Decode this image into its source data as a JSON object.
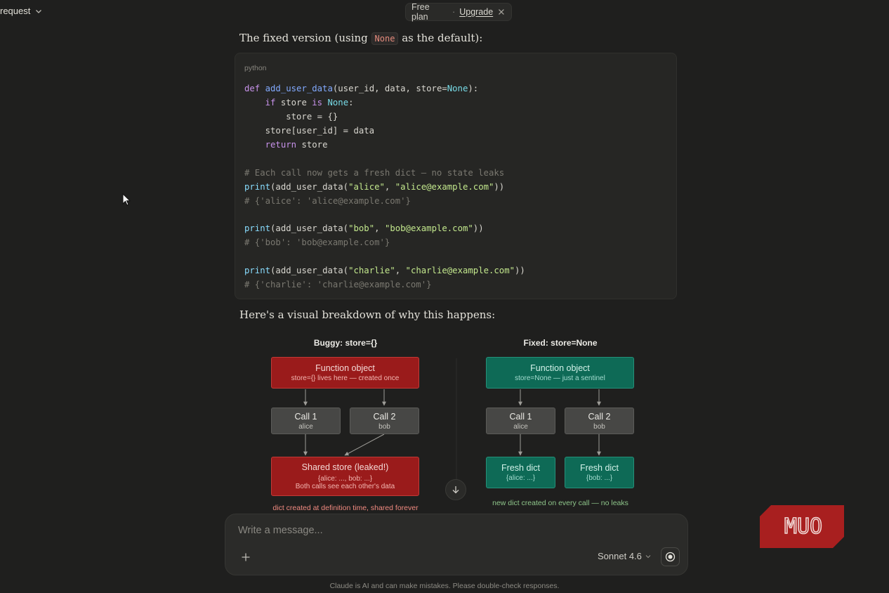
{
  "header": {
    "chat_title": "request",
    "plan": "Free plan",
    "separator": "·",
    "upgrade": "Upgrade"
  },
  "message": {
    "intro_before": "The fixed version (using ",
    "intro_code": "None",
    "intro_after": " as the default):",
    "code_language": "python",
    "code_lines": [
      "def add_user_data(user_id, data, store=None):",
      "    if store is None:",
      "        store = {}",
      "    store[user_id] = data",
      "    return store",
      "",
      "# Each call now gets a fresh dict — no state leaks",
      "print(add_user_data(\"alice\", \"alice@example.com\"))",
      "# {'alice': 'alice@example.com'}",
      "",
      "print(add_user_data(\"bob\", \"bob@example.com\"))",
      "# {'bob': 'bob@example.com'}",
      "",
      "print(add_user_data(\"charlie\", \"charlie@example.com\"))",
      "# {'charlie': 'charlie@example.com'}"
    ],
    "breakdown_heading": "Here's a visual breakdown of why this happens:"
  },
  "diagram": {
    "buggy": {
      "title": "Buggy: store={}",
      "function_title": "Function object",
      "function_sub": "store={} lives here — created once",
      "call1_title": "Call 1",
      "call1_sub": "alice",
      "call2_title": "Call 2",
      "call2_sub": "bob",
      "store_title": "Shared store (leaked!)",
      "store_sub1": "{alice: ..., bob: ...}",
      "store_sub2": "Both calls see each other's data",
      "caption": "dict created at definition time, shared forever"
    },
    "fixed": {
      "title": "Fixed: store=None",
      "function_title": "Function object",
      "function_sub": "store=None — just a sentinel",
      "call1_title": "Call 1",
      "call1_sub": "alice",
      "call2_title": "Call 2",
      "call2_sub": "bob",
      "dict1_title": "Fresh dict",
      "dict1_sub": "{alice: ...}",
      "dict2_title": "Fresh dict",
      "dict2_sub": "{bob: ...}",
      "caption": "new dict created on every call — no leaks"
    }
  },
  "composer": {
    "placeholder": "Write a message...",
    "model": "Sonnet 4.6"
  },
  "footer": {
    "disclaimer": "Claude is AI and can make mistakes. Please double-check responses."
  },
  "watermark": {
    "text": "MUO"
  },
  "icons": {
    "chat_title": "chevron-down-icon",
    "plan_close": "close-icon",
    "scroll": "arrow-down-icon",
    "attach": "plus-icon",
    "model": "chevron-down-icon",
    "voice": "voice-mode-icon",
    "cursor": "mouse-pointer-icon"
  },
  "colors": {
    "background": "#1f1f1e",
    "buggy_red": "#9a1b1b",
    "fixed_green": "#0e6a56",
    "call_grey": "#474745",
    "watermark_red": "#a81f1f"
  }
}
